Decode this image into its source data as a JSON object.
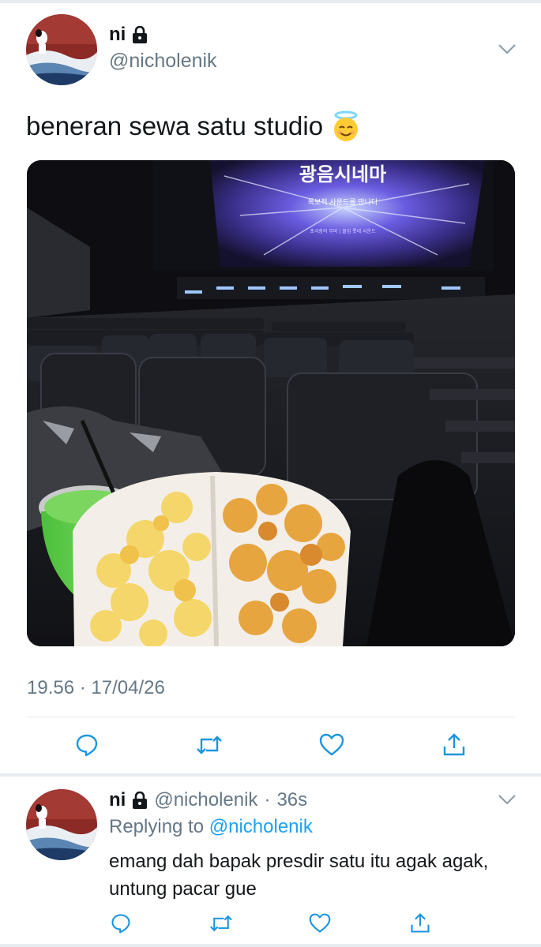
{
  "tweet": {
    "display_name": "ni",
    "handle": "@nicholenik",
    "text": "beneran sewa satu studio",
    "emoji": "smiling-face-with-halo",
    "timestamp": "19.56 · 17/04/26",
    "media": {
      "screen_title": "광음시네마",
      "screen_sub1": "독보적 사운드를 만나다",
      "screen_sub2": "초극장의 무비 | 몰입 롯데 사운드"
    }
  },
  "actions": [
    {
      "name": "reply",
      "icon": "comment-icon"
    },
    {
      "name": "retweet",
      "icon": "retweet-icon"
    },
    {
      "name": "like",
      "icon": "heart-icon"
    },
    {
      "name": "share",
      "icon": "share-icon"
    }
  ],
  "reply": {
    "display_name": "ni",
    "handle": "@nicholenik",
    "dot": "·",
    "time": "36s",
    "replying_prefix": "Replying to",
    "replying_to": "@nicholenik",
    "text": "emang dah bapak presdir satu itu agak agak, untung pacar gue"
  },
  "colors": {
    "text": "#14171a",
    "secondary": "#657786",
    "link": "#1da1f2",
    "icon": "#1b95e0",
    "divider": "#e1e8ed"
  }
}
